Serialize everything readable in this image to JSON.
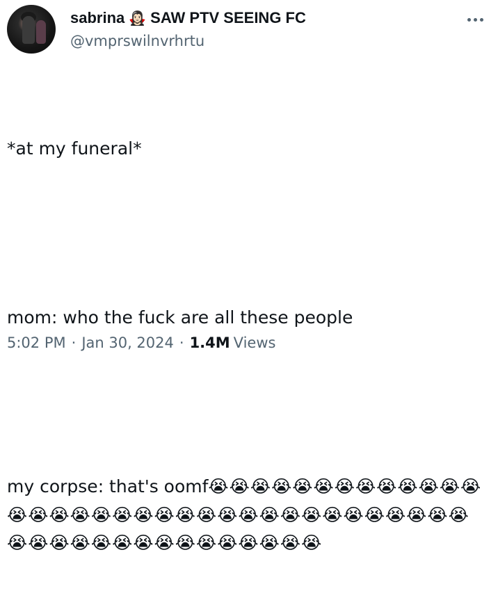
{
  "user": {
    "display_name": "sabrina",
    "title_emoji": "🧛🏻‍♀️",
    "title_suffix": "SAW PTV SEEING FC",
    "handle": "@vmprswilnvrhrtu"
  },
  "tweet": {
    "line1": "*at my funeral*",
    "line2": "mom: who the fuck are all these people",
    "line3": "my corpse: that's oomf",
    "emoji": "😭",
    "emoji_count": 50
  },
  "meta": {
    "time": "5:02 PM",
    "separator": "·",
    "date": "Jan 30, 2024",
    "views_count": "1.4M",
    "views_label": "Views"
  },
  "icons": {
    "more": "more-horizontal-icon"
  }
}
